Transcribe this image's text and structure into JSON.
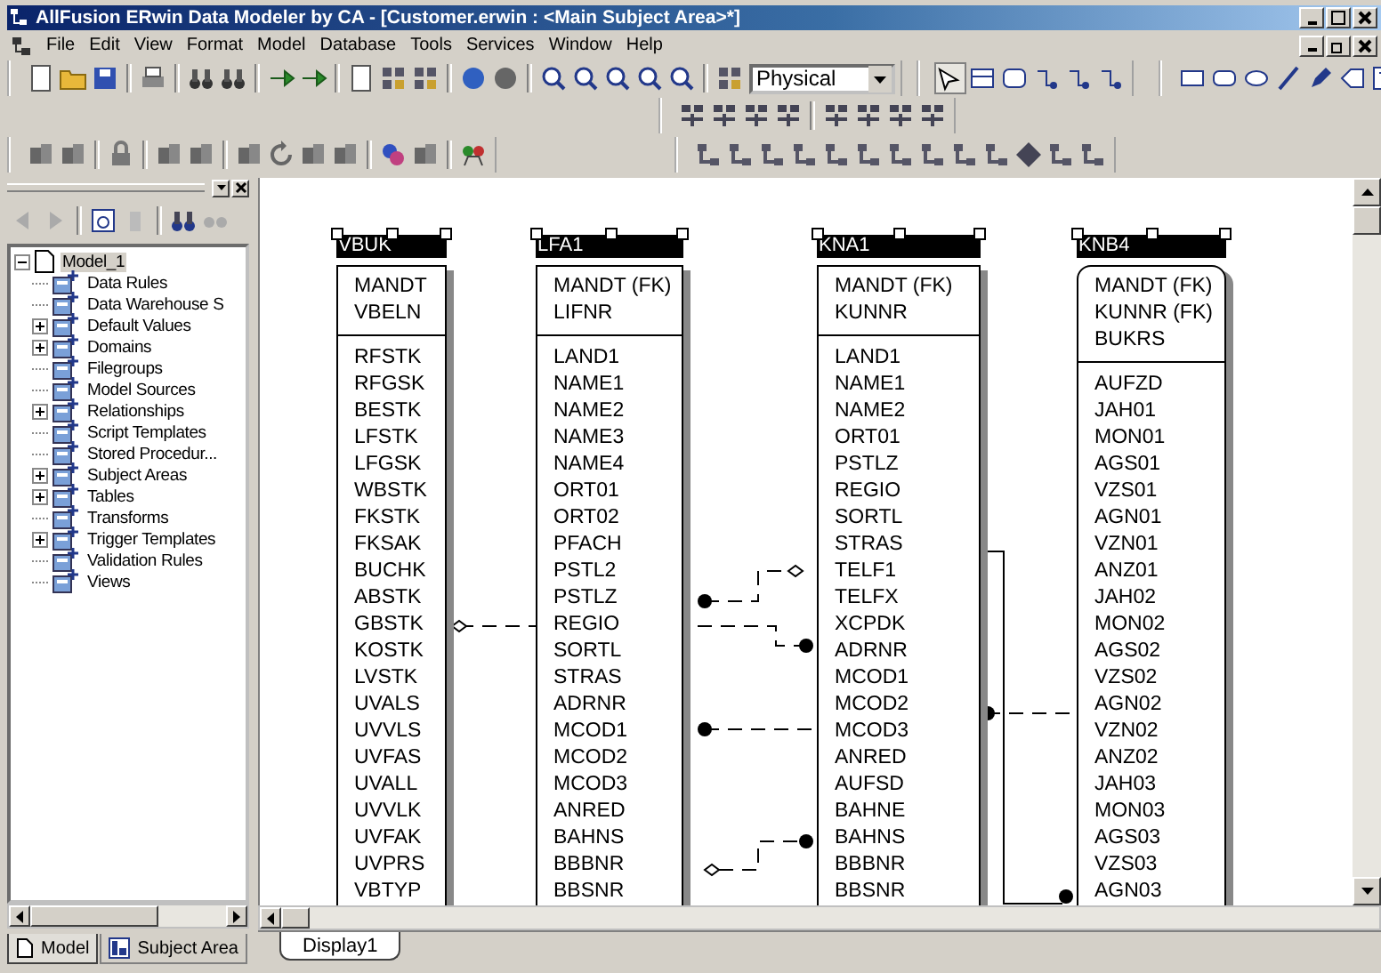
{
  "window": {
    "title": "AllFusion ERwin Data Modeler by CA - [Customer.erwin : <Main Subject Area>*]"
  },
  "menu": [
    "File",
    "Edit",
    "View",
    "Format",
    "Model",
    "Database",
    "Tools",
    "Services",
    "Window",
    "Help"
  ],
  "toolbar": {
    "notation_select": "Physical"
  },
  "model_tree": {
    "label": "Model_1",
    "expanded": true,
    "selected": true,
    "children": [
      {
        "label": "Data Rules",
        "selected": false
      },
      {
        "label": "Data Warehouse S",
        "selected": false
      },
      {
        "label": "Default Values",
        "selected": false,
        "expanded": false
      },
      {
        "label": "Domains",
        "selected": false,
        "expanded": false
      },
      {
        "label": "Filegroups",
        "selected": false
      },
      {
        "label": "Model Sources",
        "selected": false
      },
      {
        "label": "Relationships",
        "selected": false,
        "expanded": false
      },
      {
        "label": "Script Templates",
        "selected": false
      },
      {
        "label": "Stored Procedur...",
        "selected": false
      },
      {
        "label": "Subject Areas",
        "selected": false,
        "expanded": false
      },
      {
        "label": "Tables",
        "selected": false,
        "expanded": false
      },
      {
        "label": "Transforms",
        "selected": false
      },
      {
        "label": "Trigger Templates",
        "selected": false,
        "expanded": false
      },
      {
        "label": "Validation Rules",
        "selected": false
      },
      {
        "label": "Views",
        "selected": false
      }
    ]
  },
  "entities": [
    {
      "name": "VBUK",
      "kind": "independent",
      "keys": [
        "MANDT",
        "VBELN"
      ],
      "attributes": [
        "RFSTK",
        "RFGSK",
        "BESTK",
        "LFSTK",
        "LFGSK",
        "WBSTK",
        "FKSTK",
        "FKSAK",
        "BUCHK",
        "ABSTK",
        "GBSTK",
        "KOSTK",
        "LVSTK",
        "UVALS",
        "UVVLS",
        "UVFAS",
        "UVALL",
        "UVVLK",
        "UVFAK",
        "UVPRS",
        "VBTYP"
      ]
    },
    {
      "name": "LFA1",
      "kind": "independent",
      "keys": [
        "MANDT (FK)",
        "LIFNR"
      ],
      "attributes": [
        "LAND1",
        "NAME1",
        "NAME2",
        "NAME3",
        "NAME4",
        "ORT01",
        "ORT02",
        "PFACH",
        "PSTL2",
        "PSTLZ",
        "REGIO",
        "SORTL",
        "STRAS",
        "ADRNR",
        "MCOD1",
        "MCOD2",
        "MCOD3",
        "ANRED",
        "BAHNS",
        "BBBNR",
        "BBSNR"
      ]
    },
    {
      "name": "KNA1",
      "kind": "independent",
      "keys": [
        "MANDT (FK)",
        "KUNNR"
      ],
      "attributes": [
        "LAND1",
        "NAME1",
        "NAME2",
        "ORT01",
        "PSTLZ",
        "REGIO",
        "SORTL",
        "STRAS",
        "TELF1",
        "TELFX",
        "XCPDK",
        "ADRNR",
        "MCOD1",
        "MCOD2",
        "MCOD3",
        "ANRED",
        "AUFSD",
        "BAHNE",
        "BAHNS",
        "BBBNR",
        "BBSNR"
      ]
    },
    {
      "name": "KNB4",
      "kind": "dependent",
      "keys": [
        "MANDT (FK)",
        "KUNNR (FK)",
        "BUKRS"
      ],
      "attributes": [
        "AUFZD",
        "JAH01",
        "MON01",
        "AGS01",
        "VZS01",
        "AGN01",
        "VZN01",
        "ANZ01",
        "JAH02",
        "MON02",
        "AGS02",
        "VZS02",
        "AGN02",
        "VZN02",
        "ANZ02",
        "JAH03",
        "MON03",
        "AGS03",
        "VZS03",
        "AGN03"
      ]
    }
  ],
  "panel_tabs": [
    {
      "label": "Model",
      "selected": true
    },
    {
      "label": "Subject Area",
      "selected": false
    }
  ],
  "diagram_tabs": [
    {
      "label": "Display1",
      "selected": true
    }
  ]
}
